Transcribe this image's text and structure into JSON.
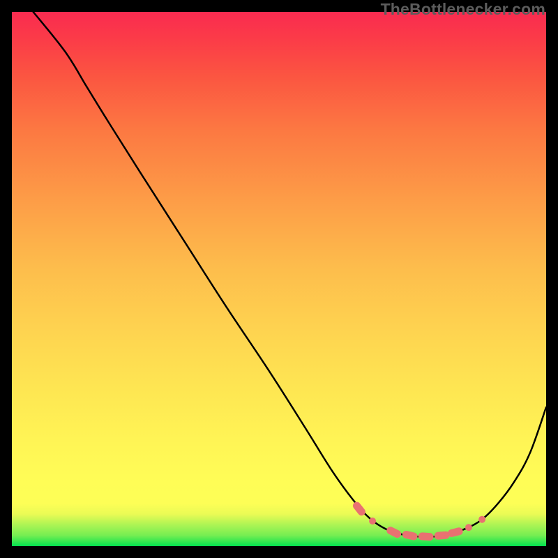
{
  "watermark": "TheBottlenecker.com",
  "colors": {
    "curve_stroke": "#000000",
    "marker_fill": "#e97171",
    "background_black": "#000000"
  },
  "chart_data": {
    "type": "line",
    "title": "",
    "xlabel": "",
    "ylabel": "",
    "xlim": [
      0,
      100
    ],
    "ylim": [
      0,
      100
    ],
    "curve_points": [
      {
        "x": 4.0,
        "y": 100.0
      },
      {
        "x": 10.0,
        "y": 92.5
      },
      {
        "x": 14.0,
        "y": 86.0
      },
      {
        "x": 18.0,
        "y": 79.5
      },
      {
        "x": 24.0,
        "y": 70.0
      },
      {
        "x": 32.0,
        "y": 57.5
      },
      {
        "x": 40.0,
        "y": 45.0
      },
      {
        "x": 48.0,
        "y": 33.0
      },
      {
        "x": 55.0,
        "y": 22.0
      },
      {
        "x": 60.0,
        "y": 14.0
      },
      {
        "x": 64.0,
        "y": 8.5
      },
      {
        "x": 67.0,
        "y": 5.2
      },
      {
        "x": 70.0,
        "y": 3.2
      },
      {
        "x": 73.0,
        "y": 2.2
      },
      {
        "x": 76.0,
        "y": 1.8
      },
      {
        "x": 79.0,
        "y": 1.8
      },
      {
        "x": 82.0,
        "y": 2.3
      },
      {
        "x": 85.0,
        "y": 3.3
      },
      {
        "x": 88.0,
        "y": 5.0
      },
      {
        "x": 91.0,
        "y": 8.0
      },
      {
        "x": 94.0,
        "y": 12.0
      },
      {
        "x": 97.0,
        "y": 17.5
      },
      {
        "x": 100.0,
        "y": 26.0
      }
    ],
    "markers": [
      {
        "x": 65.0,
        "y": 7.0,
        "kind": "blob"
      },
      {
        "x": 67.5,
        "y": 4.7,
        "kind": "dot"
      },
      {
        "x": 71.5,
        "y": 2.6,
        "kind": "blob"
      },
      {
        "x": 74.5,
        "y": 2.0,
        "kind": "blob"
      },
      {
        "x": 77.5,
        "y": 1.8,
        "kind": "blob"
      },
      {
        "x": 80.5,
        "y": 2.0,
        "kind": "blob"
      },
      {
        "x": 83.0,
        "y": 2.6,
        "kind": "blob"
      },
      {
        "x": 85.5,
        "y": 3.5,
        "kind": "dot"
      },
      {
        "x": 88.0,
        "y": 5.0,
        "kind": "dot"
      }
    ]
  }
}
